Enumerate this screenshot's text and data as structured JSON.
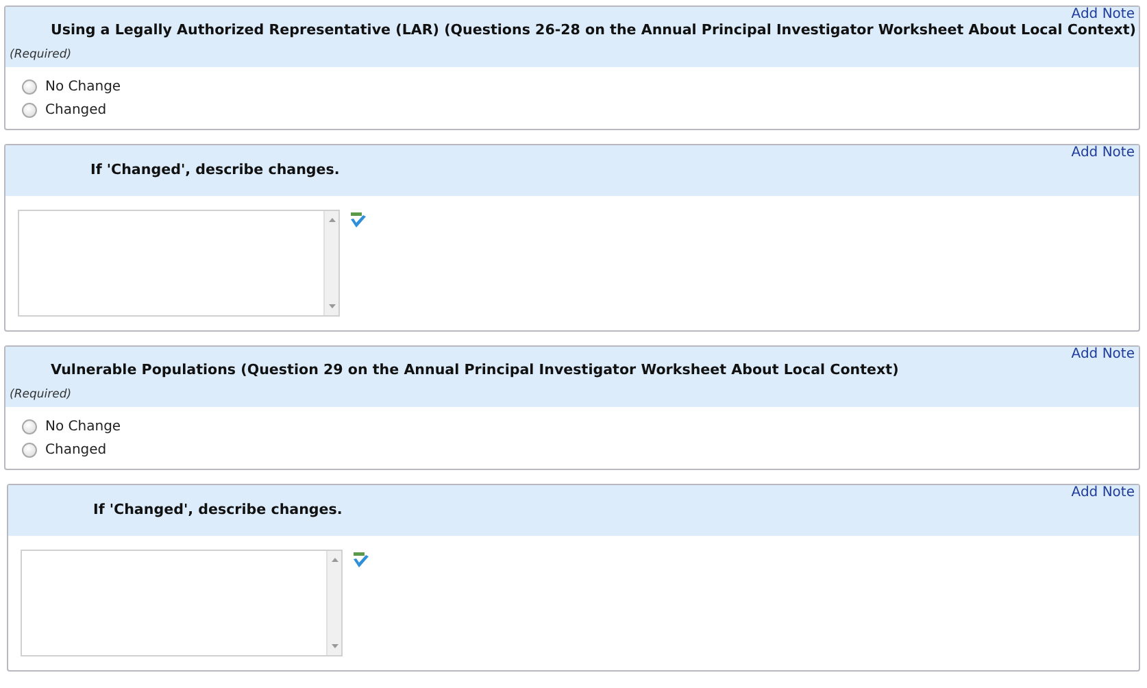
{
  "sections": [
    {
      "kind": "choice",
      "title": "Using a Legally Authorized Representative (LAR) (Questions 26-28 on the Annual Principal Investigator Worksheet About Local Context)",
      "required": "(Required)",
      "note_link": "Add Note",
      "options": [
        {
          "label": "No Change",
          "selected": false
        },
        {
          "label": "Changed",
          "selected": false
        }
      ]
    },
    {
      "kind": "text",
      "title": "If 'Changed', describe changes.",
      "note_link": "Add Note"
    },
    {
      "kind": "choice",
      "title": "Vulnerable Populations (Question 29 on the Annual Principal Investigator Worksheet About Local Context)",
      "required": "(Required)",
      "note_link": "Add Note",
      "options": [
        {
          "label": "No Change",
          "selected": false
        },
        {
          "label": "Changed",
          "selected": false
        }
      ]
    },
    {
      "kind": "text",
      "title": "If 'Changed', describe changes.",
      "note_link": "Add Note"
    }
  ]
}
